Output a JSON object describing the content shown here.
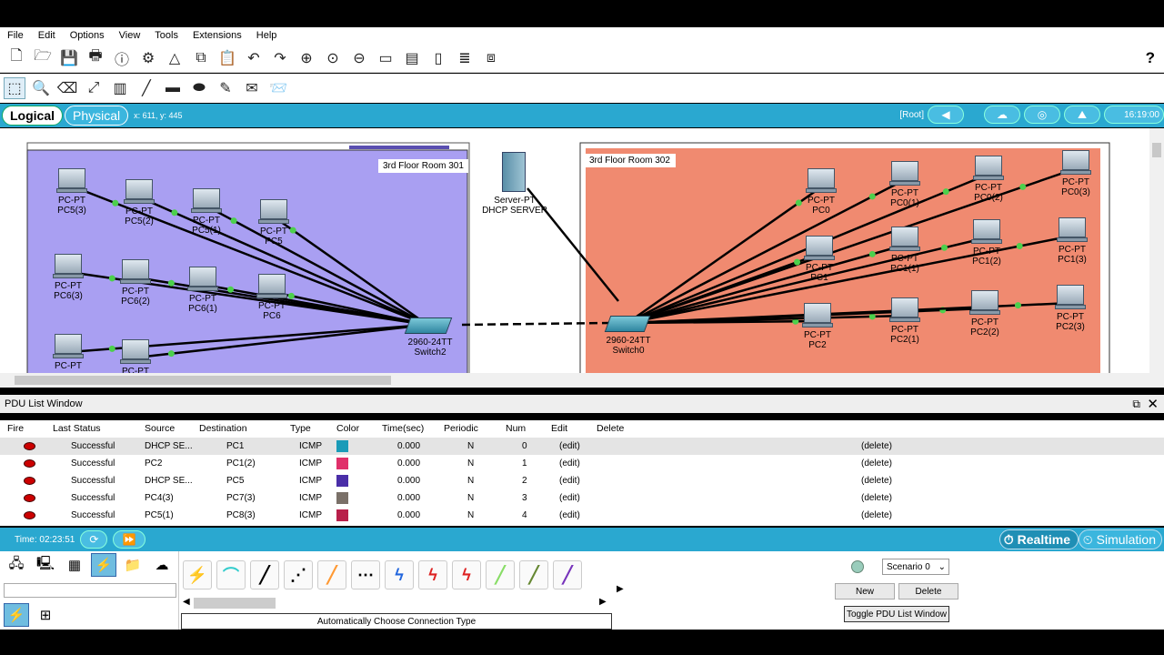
{
  "menu": [
    "File",
    "Edit",
    "Options",
    "View",
    "Tools",
    "Extensions",
    "Help"
  ],
  "mode_tabs": {
    "logical": "Logical",
    "physical": "Physical"
  },
  "coords": "x: 611, y: 445",
  "right_bar": {
    "root": "[Root]",
    "clock": "16:19:00"
  },
  "workspace": {
    "room301": "3rd Floor Room 301",
    "room302": "3rd Floor Room 302",
    "server": {
      "type": "Server-PT",
      "name": "DHCP SERVER"
    },
    "switch2": {
      "type": "2960-24TT",
      "name": "Switch2"
    },
    "switch0": {
      "type": "2960-24TT",
      "name": "Switch0"
    },
    "left_pcs": [
      {
        "t": "PC-PT",
        "n": "PC5(3)"
      },
      {
        "t": "PC-PT",
        "n": "PC5(2)"
      },
      {
        "t": "PC-PT",
        "n": "PC5(1)"
      },
      {
        "t": "PC-PT",
        "n": "PC5"
      },
      {
        "t": "PC-PT",
        "n": "PC6(3)"
      },
      {
        "t": "PC-PT",
        "n": "PC6(2)"
      },
      {
        "t": "PC-PT",
        "n": "PC6(1)"
      },
      {
        "t": "PC-PT",
        "n": "PC6"
      },
      {
        "t": "PC-PT",
        "n": ""
      },
      {
        "t": "PC-PT",
        "n": ""
      }
    ],
    "right_pcs": [
      {
        "t": "PC-PT",
        "n": "PC0"
      },
      {
        "t": "PC-PT",
        "n": "PC0(1)"
      },
      {
        "t": "PC-PT",
        "n": "PC0(2)"
      },
      {
        "t": "PC-PT",
        "n": "PC0(3)"
      },
      {
        "t": "PC-PT",
        "n": "PC1"
      },
      {
        "t": "PC-PT",
        "n": "PC1(1)"
      },
      {
        "t": "PC-PT",
        "n": "PC1(2)"
      },
      {
        "t": "PC-PT",
        "n": "PC1(3)"
      },
      {
        "t": "PC-PT",
        "n": "PC2"
      },
      {
        "t": "PC-PT",
        "n": "PC2(1)"
      },
      {
        "t": "PC-PT",
        "n": "PC2(2)"
      },
      {
        "t": "PC-PT",
        "n": "PC2(3)"
      }
    ]
  },
  "pdu": {
    "title": "PDU List Window",
    "headers": [
      "Fire",
      "Last Status",
      "Source",
      "Destination",
      "Type",
      "Color",
      "Time(sec)",
      "Periodic",
      "Num",
      "Edit",
      "Delete"
    ],
    "rows": [
      {
        "status": "Successful",
        "src": "DHCP SE...",
        "dst": "PC1",
        "type": "ICMP",
        "color": "#1a9bb8",
        "time": "0.000",
        "periodic": "N",
        "num": "0",
        "edit": "(edit)",
        "del": "(delete)"
      },
      {
        "status": "Successful",
        "src": "PC2",
        "dst": "PC1(2)",
        "type": "ICMP",
        "color": "#e0306a",
        "time": "0.000",
        "periodic": "N",
        "num": "1",
        "edit": "(edit)",
        "del": "(delete)"
      },
      {
        "status": "Successful",
        "src": "DHCP SE...",
        "dst": "PC5",
        "type": "ICMP",
        "color": "#4a2ea8",
        "time": "0.000",
        "periodic": "N",
        "num": "2",
        "edit": "(edit)",
        "del": "(delete)"
      },
      {
        "status": "Successful",
        "src": "PC4(3)",
        "dst": "PC7(3)",
        "type": "ICMP",
        "color": "#7a7068",
        "time": "0.000",
        "periodic": "N",
        "num": "3",
        "edit": "(edit)",
        "del": "(delete)"
      },
      {
        "status": "Successful",
        "src": "PC5(1)",
        "dst": "PC8(3)",
        "type": "ICMP",
        "color": "#b8204a",
        "time": "0.000",
        "periodic": "N",
        "num": "4",
        "edit": "(edit)",
        "del": "(delete)"
      }
    ]
  },
  "timebar": {
    "time": "Time: 02:23:51",
    "realtime": "Realtime",
    "simulation": "Simulation"
  },
  "bottom": {
    "conn_type": "Automatically Choose Connection Type",
    "scenario": "Scenario 0",
    "new": "New",
    "delete": "Delete",
    "toggle": "Toggle PDU List Window"
  },
  "colors": {
    "purple_room": "#a99ff2",
    "salmon_room": "#f08a70",
    "accent": "#2aa8d0"
  }
}
